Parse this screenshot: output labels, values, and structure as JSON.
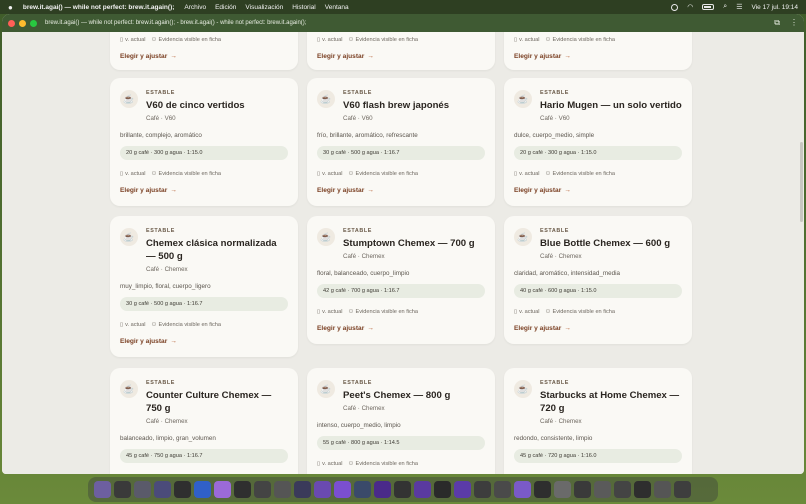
{
  "menubar": {
    "app_name": "brew.it.agai() — while not perfect: brew.it.again();",
    "menus": [
      "Archivo",
      "Edición",
      "Visualización",
      "Historial",
      "Ventana"
    ],
    "clock": "Vie 17 jul.  19:14"
  },
  "window": {
    "title": "brew.it.agai() — while not perfect: brew.it.again(); - brew.it.agai() - while not perfect: brew.it.again();"
  },
  "common": {
    "meta_version": "v. actual",
    "meta_evidence": "Evidencia visible en ficha",
    "cta_label": "Elegir y ajustar",
    "arrow": "→",
    "cup_icon": "☕"
  },
  "cards": [
    {
      "badge": "",
      "title": "",
      "subtitle": "",
      "tags": "",
      "recipe": "",
      "partial": true
    },
    {
      "badge": "",
      "title": "",
      "subtitle": "",
      "tags": "",
      "recipe": "",
      "partial": true
    },
    {
      "badge": "",
      "title": "",
      "subtitle": "",
      "tags": "",
      "recipe": "",
      "partial": true
    },
    {
      "badge": "ESTABLE",
      "title": "V60 de cinco vertidos",
      "subtitle": "Café · V60",
      "tags": "brillante, complejo, aromático",
      "recipe": "20 g café · 300 g agua · 1:15.0"
    },
    {
      "badge": "ESTABLE",
      "title": "V60 flash brew japonés",
      "subtitle": "Café · V60",
      "tags": "frío, brillante, aromático, refrescante",
      "recipe": "30 g café · 500 g agua · 1:16.7"
    },
    {
      "badge": "ESTABLE",
      "title": "Hario Mugen — un solo vertido",
      "subtitle": "Café · V60",
      "tags": "dulce, cuerpo_medio, simple",
      "recipe": "20 g café · 300 g agua · 1:15.0"
    },
    {
      "badge": "ESTABLE",
      "title": "Chemex clásica normalizada — 500 g",
      "subtitle": "Café · Chemex",
      "tags": "muy_limpio, floral, cuerpo_ligero",
      "recipe": "30 g café · 500 g agua · 1:16.7"
    },
    {
      "badge": "ESTABLE",
      "title": "Stumptown Chemex — 700 g",
      "subtitle": "Café · Chemex",
      "tags": "floral, balanceado, cuerpo_limpio",
      "recipe": "42 g café · 700 g agua · 1:16.7"
    },
    {
      "badge": "ESTABLE",
      "title": "Blue Bottle Chemex — 600 g",
      "subtitle": "Café · Chemex",
      "tags": "claridad, aromático, intensidad_media",
      "recipe": "40 g café · 600 g agua · 1:15.0"
    },
    {
      "badge": "ESTABLE",
      "title": "Counter Culture Chemex — 750 g",
      "subtitle": "Café · Chemex",
      "tags": "balanceado, limpio, gran_volumen",
      "recipe": "45 g café · 750 g agua · 1:16.7"
    },
    {
      "badge": "ESTABLE",
      "title": "Peet's Chemex — 800 g",
      "subtitle": "Café · Chemex",
      "tags": "intenso, cuerpo_medio, limpio",
      "recipe": "55 g café · 800 g agua · 1:14.5"
    },
    {
      "badge": "ESTABLE",
      "title": "Starbucks at Home Chemex — 720 g",
      "subtitle": "Café · Chemex",
      "tags": "redondo, consistente, limpio",
      "recipe": "45 g café · 720 g agua · 1:16.0"
    }
  ],
  "colors": {
    "accent": "#7a3f22",
    "titlebar": "#3f5a33",
    "recipe_bg": "#e8ece2"
  }
}
